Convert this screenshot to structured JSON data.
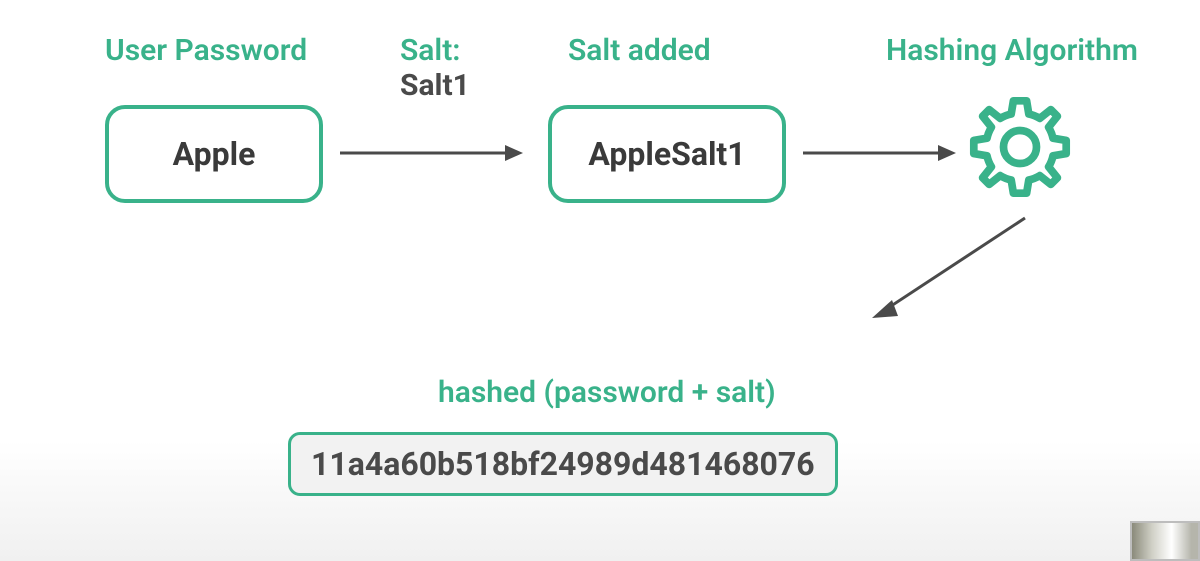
{
  "labels": {
    "user_password": "User Password",
    "salt_label": "Salt:",
    "salt_value": "Salt1",
    "salt_added": "Salt added",
    "hashing_algorithm": "Hashing Algorithm",
    "hashed_label": "hashed (password + salt)"
  },
  "boxes": {
    "password": "Apple",
    "salted": "AppleSalt1",
    "hash": "11a4a60b518bf24989d481468076"
  },
  "colors": {
    "accent": "#39b28a",
    "text": "#4a4a4a",
    "arrow": "#4a4a4a"
  }
}
